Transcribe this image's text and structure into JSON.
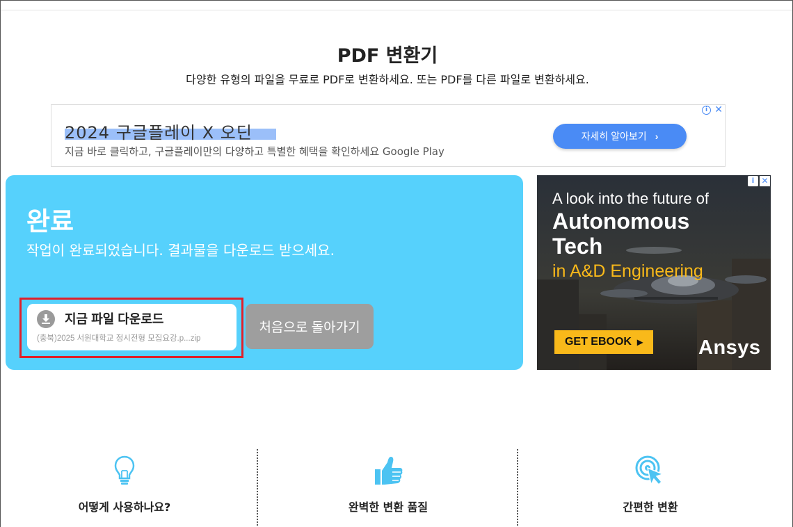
{
  "page": {
    "title": "PDF 변환기",
    "subtitle": "다양한 유형의 파일을 무료로 PDF로 변환하세요. 또는 PDF를 다른 파일로 변환하세요."
  },
  "top_ad": {
    "headline": "2024 구글플레이 X 오딘",
    "description": "지금 바로 클릭하고, 구글플레이만의 다양하고 특별한 혜택을 확인하세요 Google Play",
    "cta_label": "자세히 알아보기",
    "info_glyph": "i",
    "close_glyph": "✕"
  },
  "completion": {
    "title": "완료",
    "message": "작업이 완료되었습니다. 결과물을 다운로드 받으세요.",
    "download_label": "지금 파일 다운로드",
    "file_name": "(충북)2025 서원대학교 정시전형 모집요강.p...zip",
    "back_label": "처음으로 돌아가기"
  },
  "side_ad": {
    "line1": "A look into the future of",
    "line2": "Autonomous",
    "line3": "Tech",
    "line4": "in A&D Engineering",
    "cta_label": "GET EBOOK",
    "brand": "Ansys",
    "info_glyph": "i",
    "close_glyph": "✕"
  },
  "features": [
    {
      "label": "어떻게 사용하나요?",
      "icon": "lightbulb-icon"
    },
    {
      "label": "완벽한 변환 품질",
      "icon": "thumbs-up-icon"
    },
    {
      "label": "간편한 변환",
      "icon": "click-cursor-icon"
    }
  ],
  "colors": {
    "panel_bg": "#56d1fc",
    "back_button_bg": "#9e9e9e",
    "highlight_border": "#e0202a",
    "ad_cta_bg": "#4a8bf5",
    "side_ad_accent": "#f9b91a"
  }
}
